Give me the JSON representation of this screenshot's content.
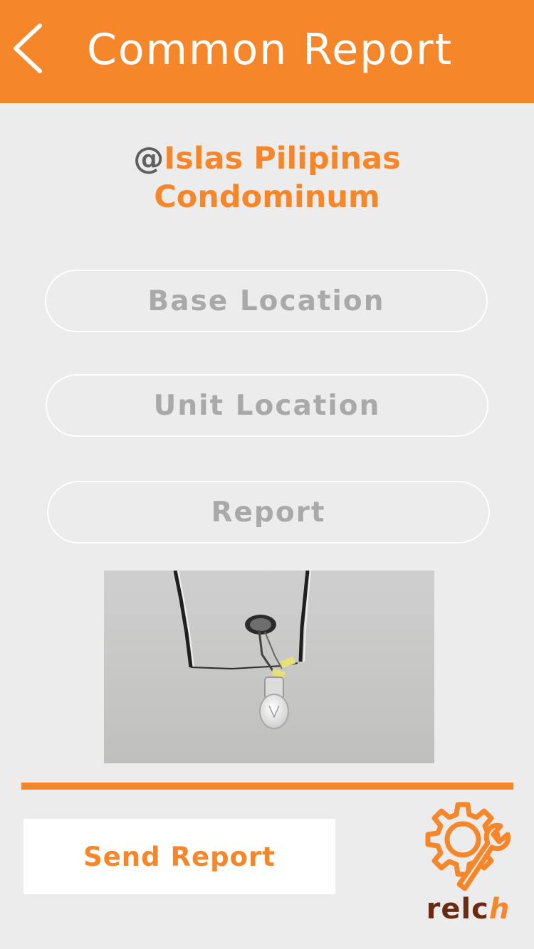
{
  "header": {
    "title": "Common Report"
  },
  "venue": {
    "at": "@",
    "line1": "Islas Pilipinas",
    "line2": "Condominum"
  },
  "fields": {
    "base_location": "Base Location",
    "unit_location": "Unit Location",
    "report": "Report"
  },
  "actions": {
    "send_label": "Send Report"
  },
  "brand": {
    "logo_prefix": "relc",
    "logo_suffix": "h"
  },
  "colors": {
    "accent": "#f5862a",
    "background": "#ececec",
    "placeholder": "#a9a9a9",
    "brand_dark": "#6b2a12"
  }
}
